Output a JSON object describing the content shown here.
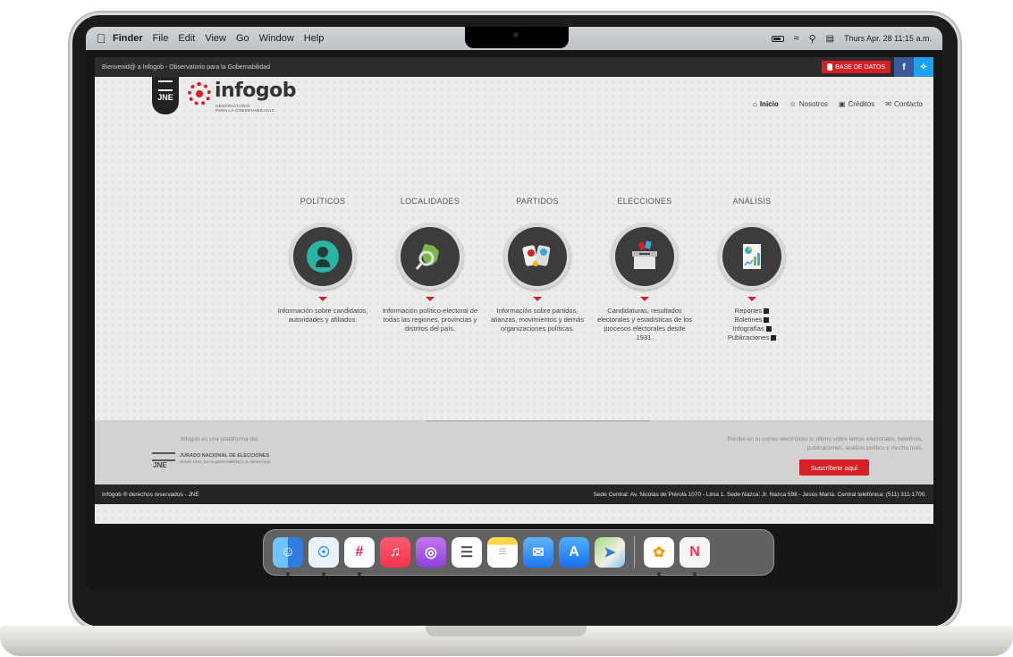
{
  "menubar": {
    "apple_icon": "apple-logo-icon",
    "app_name": "Finder",
    "menus": [
      "File",
      "Edit",
      "View",
      "Go",
      "Window",
      "Help"
    ],
    "clock": "Thurs Apr. 28 11:15 a.m."
  },
  "site": {
    "topbar": {
      "welcome": "Bienvenid@ a Infogob - Observatorio para la Gobernabilidad",
      "database_button": "BASE DE DATOS",
      "facebook": "f",
      "twitter": "✧"
    },
    "logo": {
      "shield_text": "JNE",
      "brand": "infogob",
      "sub_line1": "OBSERVATORIO",
      "sub_line2": "PARA LA GOBERNABILIDAD"
    },
    "nav": [
      {
        "label": "Inicio",
        "icon": "home-icon",
        "glyph": "⌂"
      },
      {
        "label": "Nosotros",
        "icon": "people-icon",
        "glyph": "☺"
      },
      {
        "label": "Créditos",
        "icon": "camera-icon",
        "glyph": "▣"
      },
      {
        "label": "Contacto",
        "icon": "chat-icon",
        "glyph": "✉"
      }
    ],
    "categories": [
      {
        "title": "POLÍTICOS",
        "desc": "Información sobre candidatos, autoridades y afiliados."
      },
      {
        "title": "LOCALIDADES",
        "desc": "Información político-electoral de todas las regiones, provincias y distritos del país."
      },
      {
        "title": "PARTIDOS",
        "desc": "Información sobre partidos, alianzas, movimientos y demás organizaciones políticas."
      },
      {
        "title": "ELECCIONES",
        "desc": "Candidaturas, resultados electorales y estadísticas de los procesos electorales desde 1931."
      },
      {
        "title": "ANÁLISIS",
        "links": [
          "Reportes",
          "Boletines",
          "Infografías",
          "Publicaciones"
        ]
      }
    ],
    "footer": {
      "platform_text": "Infogob es una plataforma del",
      "jne_logo_text": "JNE",
      "jne_name": "JURADO NACIONAL DE ELECCIONES",
      "jne_tagline": "Desde 1931, por la gobernabilidad y la democracia",
      "newsletter_text": "Recibe en tu correo electrónico lo último sobre temas electorales, boletines, publicaciones, análisis político y mucho más.",
      "subscribe_button": "Suscríbete aquí"
    },
    "bottombar": {
      "rights": "Infogob ® derechos reservados - JNE",
      "address": "Sede Central: Av. Nicolás de Piérola 1070 - Lima 1. Sede Nazca: Jr. Nazca 598 - Jesús María. Central telefónica: (511) 311-1700."
    }
  },
  "dock": [
    {
      "name": "Finder",
      "icon": "finder-icon",
      "glyph": "☺",
      "color": "#3b8ef0",
      "running": true
    },
    {
      "name": "Safari",
      "icon": "safari-icon",
      "glyph": "☉",
      "color": "#2d8cf0",
      "running": true
    },
    {
      "name": "Slack",
      "icon": "slack-icon",
      "glyph": "#",
      "color": "#ffffff",
      "running": true
    },
    {
      "name": "Music",
      "icon": "music-icon",
      "glyph": "♫",
      "color": "#f5455c",
      "running": false
    },
    {
      "name": "Podcasts",
      "icon": "podcasts-icon",
      "glyph": "◎",
      "color": "#a259e6",
      "running": false
    },
    {
      "name": "Reminders",
      "icon": "reminders-icon",
      "glyph": "☰",
      "color": "#ffffff",
      "running": false
    },
    {
      "name": "Notes",
      "icon": "notes-icon",
      "glyph": "≡",
      "color": "#fbd745",
      "running": false
    },
    {
      "name": "Mail",
      "icon": "mail-icon",
      "glyph": "✉",
      "color": "#3a8ff5",
      "running": false
    },
    {
      "name": "App Store",
      "icon": "app-store-icon",
      "glyph": "A",
      "color": "#2f8af5",
      "running": false
    },
    {
      "name": "Maps",
      "icon": "maps-icon",
      "glyph": "➤",
      "color": "#6cc26f",
      "running": false
    },
    {
      "name": "Photos",
      "icon": "photos-icon",
      "glyph": "✿",
      "color": "#ffffff",
      "running": true
    },
    {
      "name": "News",
      "icon": "news-icon",
      "glyph": "N",
      "color": "#f5f5f5",
      "running": true
    }
  ],
  "colors": {
    "accent_red": "#d81f26",
    "dark_bar": "#2c2c2c",
    "facebook": "#3b5998",
    "twitter": "#1da1f2"
  }
}
